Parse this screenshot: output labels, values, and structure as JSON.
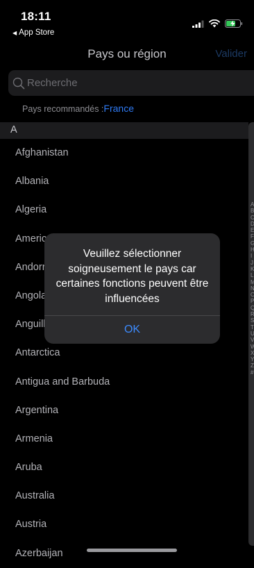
{
  "status_bar": {
    "time": "18:11",
    "back_label": "App Store"
  },
  "nav": {
    "title": "Pays ou région",
    "action": "Valider"
  },
  "search": {
    "placeholder": "Recherche"
  },
  "recommended": {
    "label": "Pays recommandés :",
    "country": "France"
  },
  "section_header": "A",
  "countries": [
    "Afghanistan",
    "Albania",
    "Algeria",
    "American Samoa",
    "Andorra",
    "Angola",
    "Anguilla",
    "Antarctica",
    "Antigua and Barbuda",
    "Argentina",
    "Armenia",
    "Aruba",
    "Australia",
    "Austria",
    "Azerbaijan"
  ],
  "index_letters": [
    "A",
    "B",
    "C",
    "D",
    "E",
    "F",
    "G",
    "H",
    "I",
    "J",
    "K",
    "L",
    "M",
    "N",
    "O",
    "P",
    "Q",
    "R",
    "S",
    "T",
    "U",
    "V",
    "W",
    "X",
    "Y",
    "Z",
    "#"
  ],
  "alert": {
    "message": "Veuillez sélectionner soigneusement le pays car certaines fonctions peuvent être influencées",
    "ok": "OK"
  },
  "colors": {
    "accent": "#3d8bfd",
    "link": "#2f7bf5",
    "disabled_action": "#1c3a63"
  }
}
